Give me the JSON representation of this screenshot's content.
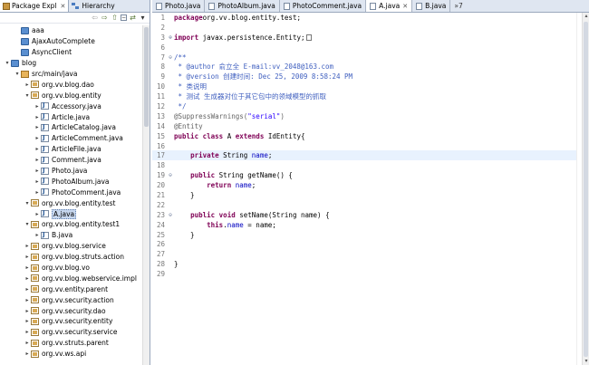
{
  "left_view": {
    "tabs": [
      {
        "label": "Package Expl",
        "icon": "package-icon",
        "active": true
      },
      {
        "label": "Hierarchy",
        "icon": "hierarchy-icon",
        "active": false
      }
    ],
    "toolbar": [
      "back-icon",
      "forward-icon",
      "up-icon",
      "collapse-all-icon",
      "link-editor-icon",
      "view-menu-icon"
    ],
    "tree": [
      {
        "label": "aaa",
        "indent": 1,
        "icon": "proj",
        "twisty": ""
      },
      {
        "label": "AjaxAutoComplete",
        "indent": 1,
        "icon": "proj",
        "twisty": ""
      },
      {
        "label": "AsyncClient",
        "indent": 1,
        "icon": "proj",
        "twisty": ""
      },
      {
        "label": "blog",
        "indent": 0,
        "icon": "proj",
        "twisty": "▾"
      },
      {
        "label": "src/main/java",
        "indent": 1,
        "icon": "src",
        "twisty": "▾"
      },
      {
        "label": "org.vv.blog.dao",
        "indent": 2,
        "icon": "pkg",
        "twisty": "▸"
      },
      {
        "label": "org.vv.blog.entity",
        "indent": 2,
        "icon": "pkg",
        "twisty": "▾"
      },
      {
        "label": "Accessory.java",
        "indent": 3,
        "icon": "java",
        "twisty": "▸"
      },
      {
        "label": "Article.java",
        "indent": 3,
        "icon": "java",
        "twisty": "▸"
      },
      {
        "label": "ArticleCatalog.java",
        "indent": 3,
        "icon": "java",
        "twisty": "▸"
      },
      {
        "label": "ArticleComment.java",
        "indent": 3,
        "icon": "java",
        "twisty": "▸"
      },
      {
        "label": "ArticleFile.java",
        "indent": 3,
        "icon": "java",
        "twisty": "▸"
      },
      {
        "label": "Comment.java",
        "indent": 3,
        "icon": "java",
        "twisty": "▸"
      },
      {
        "label": "Photo.java",
        "indent": 3,
        "icon": "java",
        "twisty": "▸"
      },
      {
        "label": "PhotoAlbum.java",
        "indent": 3,
        "icon": "java",
        "twisty": "▸"
      },
      {
        "label": "PhotoComment.java",
        "indent": 3,
        "icon": "java",
        "twisty": "▸"
      },
      {
        "label": "org.vv.blog.entity.test",
        "indent": 2,
        "icon": "pkg",
        "twisty": "▾"
      },
      {
        "label": "A.java",
        "indent": 3,
        "icon": "java",
        "twisty": "▸",
        "selected": true
      },
      {
        "label": "org.vv.blog.entity.test1",
        "indent": 2,
        "icon": "pkg",
        "twisty": "▾"
      },
      {
        "label": "B.java",
        "indent": 3,
        "icon": "java",
        "twisty": "▸"
      },
      {
        "label": "org.vv.blog.service",
        "indent": 2,
        "icon": "pkg",
        "twisty": "▸"
      },
      {
        "label": "org.vv.blog.struts.action",
        "indent": 2,
        "icon": "pkg",
        "twisty": "▸"
      },
      {
        "label": "org.vv.blog.vo",
        "indent": 2,
        "icon": "pkg",
        "twisty": "▸"
      },
      {
        "label": "org.vv.blog.webservice.impl",
        "indent": 2,
        "icon": "pkg",
        "twisty": "▸"
      },
      {
        "label": "org.vv.entity.parent",
        "indent": 2,
        "icon": "pkg",
        "twisty": "▸"
      },
      {
        "label": "org.vv.security.action",
        "indent": 2,
        "icon": "pkg",
        "twisty": "▸"
      },
      {
        "label": "org.vv.security.dao",
        "indent": 2,
        "icon": "pkg",
        "twisty": "▸"
      },
      {
        "label": "org.vv.security.entity",
        "indent": 2,
        "icon": "pkg",
        "twisty": "▸"
      },
      {
        "label": "org.vv.security.service",
        "indent": 2,
        "icon": "pkg",
        "twisty": "▸"
      },
      {
        "label": "org.vv.struts.parent",
        "indent": 2,
        "icon": "pkg",
        "twisty": "▸"
      },
      {
        "label": "org.vv.ws.api",
        "indent": 2,
        "icon": "pkg",
        "twisty": "▸"
      }
    ]
  },
  "editor": {
    "tabs": [
      {
        "label": "Photo.java",
        "active": false,
        "closable": false
      },
      {
        "label": "PhotoAlbum.java",
        "active": false,
        "closable": false
      },
      {
        "label": "PhotoComment.java",
        "active": false,
        "closable": false
      },
      {
        "label": "A.java",
        "active": true,
        "closable": true
      },
      {
        "label": "B.java",
        "active": false,
        "closable": false
      }
    ],
    "more_tabs": "»7",
    "lines": [
      {
        "n": "1",
        "fold": "",
        "segs": [
          [
            "kw",
            "package"
          ],
          [
            "",
            "org.vv.blog.entity.test;"
          ]
        ]
      },
      {
        "n": "2",
        "fold": "",
        "segs": []
      },
      {
        "n": "3",
        "fold": "⊕",
        "segs": [
          [
            "kw",
            "import"
          ],
          [
            "",
            " javax.persistence.Entity;"
          ],
          [
            "box",
            ""
          ]
        ]
      },
      {
        "n": "6",
        "fold": "",
        "segs": []
      },
      {
        "n": "7",
        "fold": "⊖",
        "segs": [
          [
            "cm",
            "/**"
          ]
        ]
      },
      {
        "n": "8",
        "fold": "",
        "segs": [
          [
            "cm",
            " * @author 俞立全 E-mail:vv_2048@163.com"
          ]
        ]
      },
      {
        "n": "9",
        "fold": "",
        "segs": [
          [
            "cm",
            " * @version 创建时间: Dec 25, 2009 8:58:24 PM"
          ]
        ]
      },
      {
        "n": "10",
        "fold": "",
        "segs": [
          [
            "cm",
            " * 类说明"
          ]
        ]
      },
      {
        "n": "11",
        "fold": "",
        "segs": [
          [
            "cm",
            " * 测试 生成器对位于其它包中的领域模型的抓取"
          ]
        ]
      },
      {
        "n": "12",
        "fold": "",
        "segs": [
          [
            "cm",
            " */"
          ]
        ]
      },
      {
        "n": "13",
        "fold": "",
        "segs": [
          [
            "ann",
            "@SuppressWarnings("
          ],
          [
            "str",
            "\"serial\""
          ],
          [
            "ann",
            ")"
          ]
        ]
      },
      {
        "n": "14",
        "fold": "",
        "segs": [
          [
            "ann",
            "@Entity"
          ]
        ]
      },
      {
        "n": "15",
        "fold": "",
        "segs": [
          [
            "kw",
            "public class"
          ],
          [
            "",
            " A "
          ],
          [
            "kw",
            "extends"
          ],
          [
            "",
            " IdEntity{"
          ]
        ]
      },
      {
        "n": "16",
        "fold": "",
        "segs": []
      },
      {
        "n": "17",
        "fold": "",
        "cur": true,
        "segs": [
          [
            "",
            "    "
          ],
          [
            "kw",
            "private"
          ],
          [
            "",
            " String "
          ],
          [
            "fld",
            "name"
          ],
          [
            "",
            ";"
          ]
        ]
      },
      {
        "n": "18",
        "fold": "",
        "segs": []
      },
      {
        "n": "19",
        "fold": "⊖",
        "segs": [
          [
            "",
            "    "
          ],
          [
            "kw",
            "public"
          ],
          [
            "",
            " String getName() {"
          ]
        ]
      },
      {
        "n": "20",
        "fold": "",
        "segs": [
          [
            "",
            "        "
          ],
          [
            "kw",
            "return"
          ],
          [
            "",
            " "
          ],
          [
            "fld",
            "name"
          ],
          [
            "",
            ";"
          ]
        ]
      },
      {
        "n": "21",
        "fold": "",
        "segs": [
          [
            "",
            "    }"
          ]
        ]
      },
      {
        "n": "22",
        "fold": "",
        "segs": []
      },
      {
        "n": "23",
        "fold": "⊖",
        "segs": [
          [
            "",
            "    "
          ],
          [
            "kw",
            "public void"
          ],
          [
            "",
            " setName(String name) {"
          ]
        ]
      },
      {
        "n": "24",
        "fold": "",
        "segs": [
          [
            "",
            "        "
          ],
          [
            "kw",
            "this"
          ],
          [
            "",
            "."
          ],
          [
            "fld",
            "name"
          ],
          [
            "",
            " = name;"
          ]
        ]
      },
      {
        "n": "25",
        "fold": "",
        "segs": [
          [
            "",
            "    }"
          ]
        ]
      },
      {
        "n": "26",
        "fold": "",
        "segs": []
      },
      {
        "n": "27",
        "fold": "",
        "segs": []
      },
      {
        "n": "28",
        "fold": "",
        "segs": [
          [
            "",
            "}"
          ]
        ]
      },
      {
        "n": "29",
        "fold": "",
        "segs": []
      }
    ]
  },
  "colors": {
    "keyword": "#7f0055",
    "string": "#2a00ff",
    "field": "#0000c0",
    "comment": "#3f5fbf",
    "current_line": "#e8f2fe",
    "tab_bar": "#dfe6f1"
  }
}
